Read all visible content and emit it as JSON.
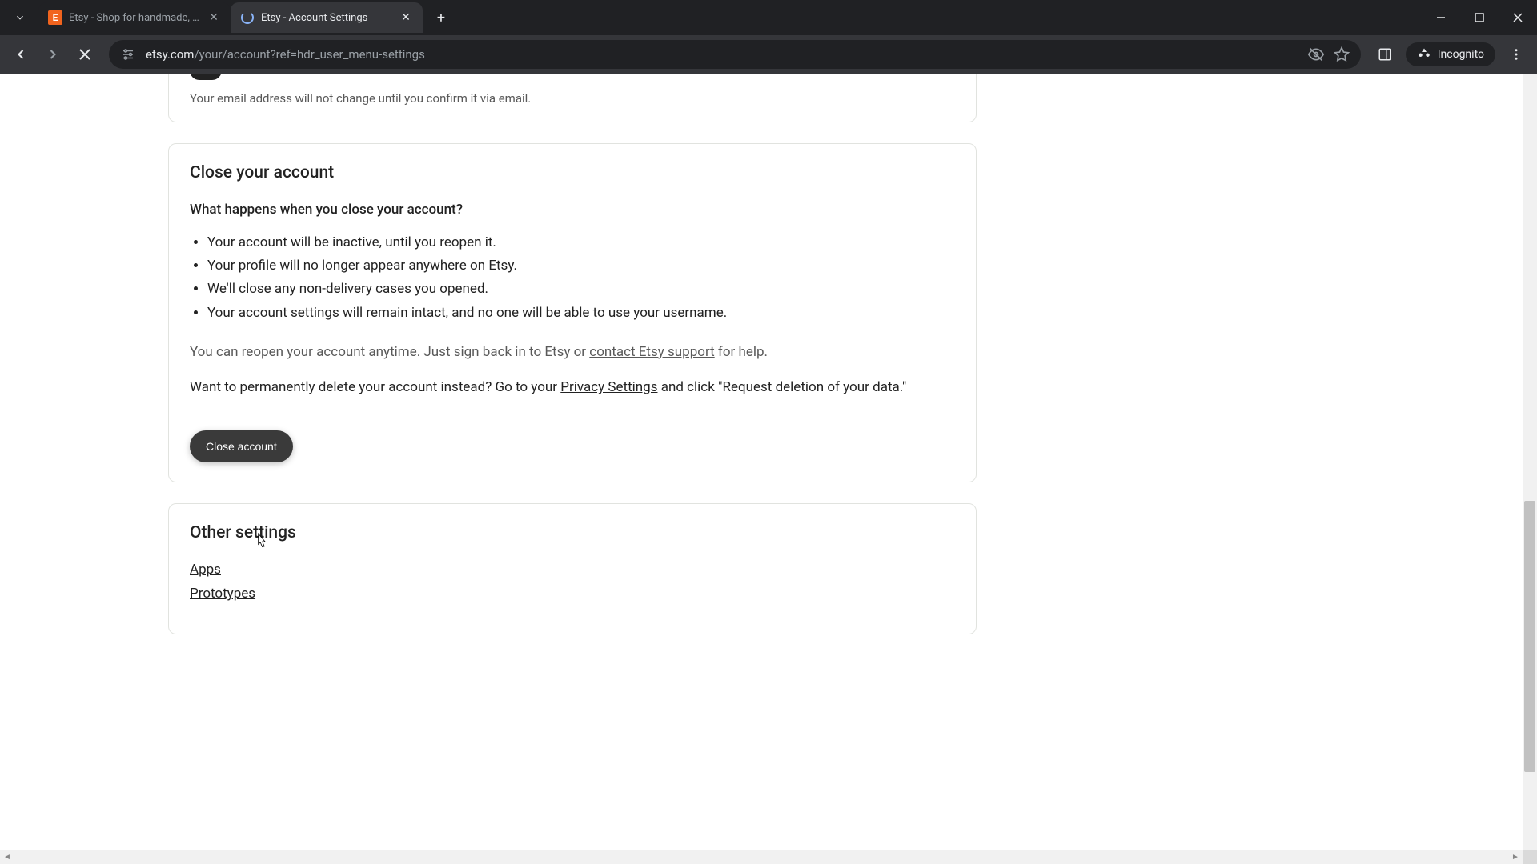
{
  "browser": {
    "tabs": [
      {
        "title": "Etsy - Shop for handmade, vint",
        "active": false
      },
      {
        "title": "Etsy - Account Settings",
        "active": true
      }
    ],
    "url_domain": "etsy.com",
    "url_path": "/your/account?ref=hdr_user_menu-settings",
    "incognito_label": "Incognito"
  },
  "email_card": {
    "helper": "Your email address will not change until you confirm it via email."
  },
  "close_account": {
    "title": "Close your account",
    "question": "What happens when you close your account?",
    "bullets": [
      "Your account will be inactive, until you reopen it.",
      "Your profile will no longer appear anywhere on Etsy.",
      "We'll close any non-delivery cases you opened.",
      "Your account settings will remain intact, and no one will be able to use your username."
    ],
    "reopen_pre": "You can reopen your account anytime. Just sign back in to Etsy or ",
    "reopen_link": "contact Etsy support",
    "reopen_post": " for help.",
    "delete_pre": "Want to permanently delete your account instead? Go to your ",
    "delete_link": "Privacy Settings",
    "delete_post": " and click \"Request deletion of your data.\"",
    "button": "Close account"
  },
  "other_settings": {
    "title": "Other settings",
    "links": [
      "Apps",
      "Prototypes"
    ]
  }
}
